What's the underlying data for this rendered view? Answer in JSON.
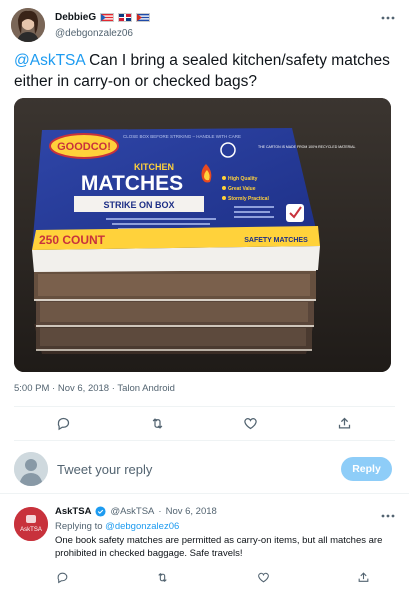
{
  "tweet": {
    "author_name": "DebbieG",
    "author_handle": "@debgonzalez06",
    "text_mention": "@AskTSA",
    "text_body": " Can I bring a sealed kitchen/safety matches either in carry-on or checked bags?",
    "photo": {
      "brand_logo": "GOODCO!",
      "top_warning": "CLOSE BOX BEFORE STRIKING – HANDLE WITH CARE",
      "product_title_small": "KITCHEN",
      "product_title": "MATCHES",
      "product_subtitle": "STRIKE ON BOX",
      "count": "250 COUNT",
      "side_label": "SAFETY MATCHES",
      "recycle_text": "THE CARTON IS MADE FROM 100% RECYCLED MATERIAL",
      "features": [
        "High Quality",
        "Great Value",
        "Stormly Practical"
      ]
    },
    "time": "5:00 PM",
    "date": "Nov 6, 2018",
    "source": "Talon Android"
  },
  "reply_box": {
    "placeholder": "Tweet your reply",
    "button_label": "Reply"
  },
  "reply": {
    "author_name": "AskTSA",
    "author_handle": "@AskTSA",
    "date": "Nov 6, 2018",
    "avatar_text": "AskTSA",
    "replying_to_label": "Replying to",
    "replying_to_handle": "@debgonzalez06",
    "text": "One book safety matches are permitted as carry-on items, but all matches are prohibited in checked baggage. Safe travels!"
  },
  "colors": {
    "accent": "#1d9bf0",
    "verified": "#1d9bf0",
    "tsa_red": "#c8323c"
  }
}
